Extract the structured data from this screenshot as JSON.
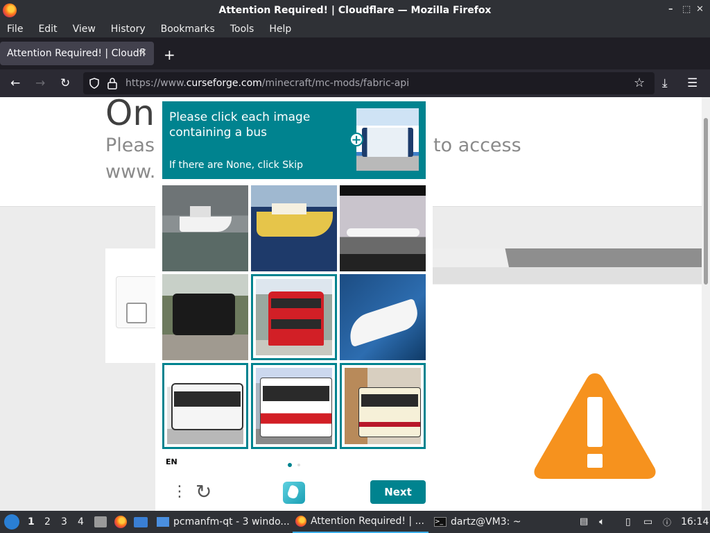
{
  "window": {
    "title": "Attention Required! | Cloudflare — Mozilla Firefox",
    "controls": [
      "–",
      "⬚",
      "✕"
    ]
  },
  "menu": [
    "File",
    "Edit",
    "View",
    "History",
    "Bookmarks",
    "Tools",
    "Help"
  ],
  "tab": {
    "title": "Attention Required! | Cloudfl",
    "close": "✕",
    "new_tab": "+"
  },
  "url": {
    "scheme": "https://www.",
    "host": "curseforge.com",
    "path": "/minecraft/mc-mods/fabric-api"
  },
  "page": {
    "heading": "On",
    "text_left_1": "Pleas",
    "text_left_2": "www.",
    "text_right": "to access"
  },
  "captcha": {
    "prompt": "Please click each image containing a bus",
    "skip_hint": "If there are None, click Skip",
    "tiles": [
      {
        "name": "yacht",
        "selected": false
      },
      {
        "name": "yellow-ship",
        "selected": false
      },
      {
        "name": "airplane",
        "selected": false
      },
      {
        "name": "steam-train",
        "selected": false
      },
      {
        "name": "double-decker-bus",
        "selected": true
      },
      {
        "name": "speedboat",
        "selected": false
      },
      {
        "name": "white-bus",
        "selected": true
      },
      {
        "name": "red-white-bus",
        "selected": true
      },
      {
        "name": "city-bus",
        "selected": true
      }
    ],
    "language": "EN",
    "next_label": "Next"
  },
  "taskbar": {
    "workspaces": [
      "1",
      "2",
      "3",
      "4"
    ],
    "tasks": [
      {
        "label": "pcmanfm-qt - 3 windo...",
        "active": false
      },
      {
        "label": "Attention Required! | ...",
        "active": true
      },
      {
        "label": "dartz@VM3: ~",
        "active": false
      }
    ],
    "clock": "16:14"
  },
  "colors": {
    "accent": "#00838f",
    "warning": "#f6921e"
  }
}
